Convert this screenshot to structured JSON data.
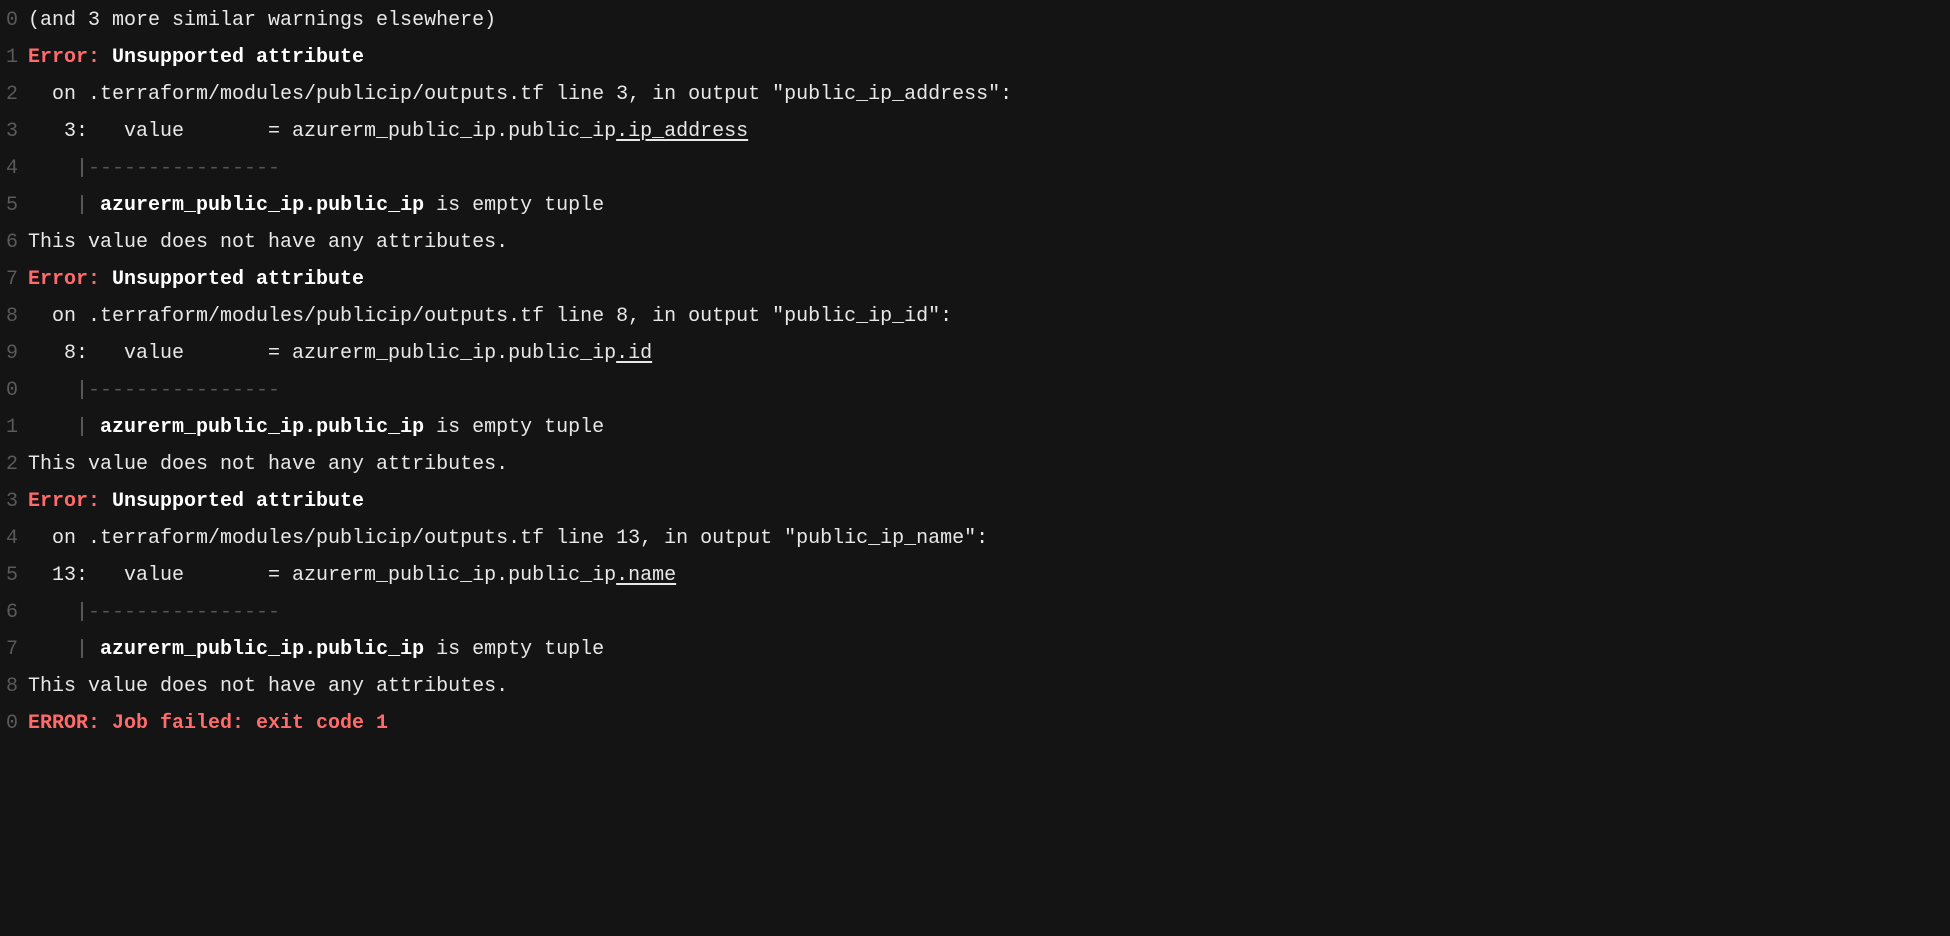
{
  "lines": [
    {
      "num": "0",
      "segs": [
        {
          "cls": "plain",
          "text": "(and 3 more similar warnings elsewhere)"
        }
      ]
    },
    {
      "num": "1",
      "segs": [
        {
          "cls": "err-label",
          "text": "Error: "
        },
        {
          "cls": "err-title",
          "text": "Unsupported attribute"
        }
      ]
    },
    {
      "num": "2",
      "segs": [
        {
          "cls": "plain",
          "text": "  on .terraform/modules/publicip/outputs.tf line 3, in output \"public_ip_address\":"
        }
      ]
    },
    {
      "num": "3",
      "segs": [
        {
          "cls": "plain",
          "text": "   3:   value       = azurerm_public_ip.public_ip"
        },
        {
          "cls": "plain underline",
          "text": ".ip_address"
        }
      ]
    },
    {
      "num": "4",
      "segs": [
        {
          "cls": "plain",
          "text": "    "
        },
        {
          "cls": "pipe",
          "text": "|"
        },
        {
          "cls": "dashes",
          "text": "----------------"
        }
      ]
    },
    {
      "num": "5",
      "segs": [
        {
          "cls": "plain",
          "text": "    "
        },
        {
          "cls": "pipe",
          "text": "| "
        },
        {
          "cls": "bold",
          "text": "azurerm_public_ip.public_ip"
        },
        {
          "cls": "plain",
          "text": " is empty tuple"
        }
      ]
    },
    {
      "num": "6",
      "segs": [
        {
          "cls": "plain",
          "text": "This value does not have any attributes."
        }
      ]
    },
    {
      "num": "7",
      "segs": [
        {
          "cls": "err-label",
          "text": "Error: "
        },
        {
          "cls": "err-title",
          "text": "Unsupported attribute"
        }
      ]
    },
    {
      "num": "8",
      "segs": [
        {
          "cls": "plain",
          "text": "  on .terraform/modules/publicip/outputs.tf line 8, in output \"public_ip_id\":"
        }
      ]
    },
    {
      "num": "9",
      "segs": [
        {
          "cls": "plain",
          "text": "   8:   value       = azurerm_public_ip.public_ip"
        },
        {
          "cls": "plain underline",
          "text": ".id"
        }
      ]
    },
    {
      "num": "0",
      "segs": [
        {
          "cls": "plain",
          "text": "    "
        },
        {
          "cls": "pipe",
          "text": "|"
        },
        {
          "cls": "dashes",
          "text": "----------------"
        }
      ]
    },
    {
      "num": "1",
      "segs": [
        {
          "cls": "plain",
          "text": "    "
        },
        {
          "cls": "pipe",
          "text": "| "
        },
        {
          "cls": "bold",
          "text": "azurerm_public_ip.public_ip"
        },
        {
          "cls": "plain",
          "text": " is empty tuple"
        }
      ]
    },
    {
      "num": "2",
      "segs": [
        {
          "cls": "plain",
          "text": "This value does not have any attributes."
        }
      ]
    },
    {
      "num": "3",
      "segs": [
        {
          "cls": "err-label",
          "text": "Error: "
        },
        {
          "cls": "err-title",
          "text": "Unsupported attribute"
        }
      ]
    },
    {
      "num": "4",
      "segs": [
        {
          "cls": "plain",
          "text": "  on .terraform/modules/publicip/outputs.tf line 13, in output \"public_ip_name\":"
        }
      ]
    },
    {
      "num": "5",
      "segs": [
        {
          "cls": "plain",
          "text": "  13:   value       = azurerm_public_ip.public_ip"
        },
        {
          "cls": "plain underline",
          "text": ".name"
        }
      ]
    },
    {
      "num": "6",
      "segs": [
        {
          "cls": "plain",
          "text": "    "
        },
        {
          "cls": "pipe",
          "text": "|"
        },
        {
          "cls": "dashes",
          "text": "----------------"
        }
      ]
    },
    {
      "num": "7",
      "segs": [
        {
          "cls": "plain",
          "text": "    "
        },
        {
          "cls": "pipe",
          "text": "| "
        },
        {
          "cls": "bold",
          "text": "azurerm_public_ip.public_ip"
        },
        {
          "cls": "plain",
          "text": " is empty tuple"
        }
      ]
    },
    {
      "num": "8",
      "segs": [
        {
          "cls": "plain",
          "text": "This value does not have any attributes."
        }
      ]
    },
    {
      "num": "0",
      "segs": [
        {
          "cls": "final-error",
          "text": "ERROR: Job failed: exit code 1"
        }
      ]
    }
  ]
}
